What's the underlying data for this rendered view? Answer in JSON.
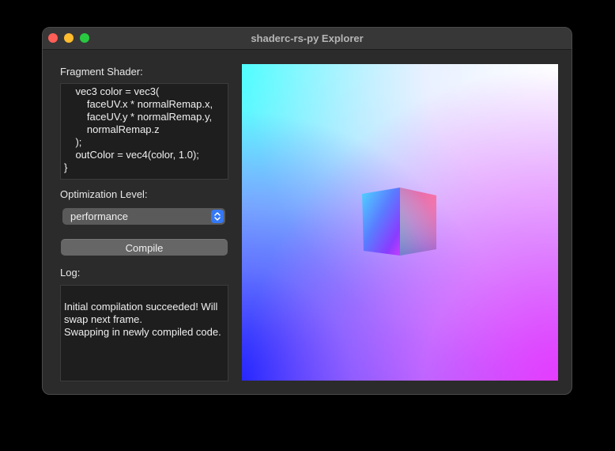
{
  "window": {
    "title": "shaderc-rs-py Explorer"
  },
  "shader": {
    "label": "Fragment Shader:",
    "code_lines": [
      "    vec3 color = vec3(",
      "        faceUV.x * normalRemap.x,",
      "        faceUV.y * normalRemap.y,",
      "        normalRemap.z",
      "    );",
      "    outColor = vec4(color, 1.0);",
      "}"
    ]
  },
  "optimization": {
    "label": "Optimization Level:",
    "selected": "performance"
  },
  "compile": {
    "label": "Compile"
  },
  "log": {
    "label": "Log:",
    "text": "Initial compilation succeeded! Will swap next frame.\nSwapping in newly compiled code."
  },
  "colors": {
    "window_bg": "#2b2b2b",
    "titlebar_bg": "#373737",
    "accent": "#3478f6",
    "close": "#ff5f57",
    "minimize": "#febc2e",
    "maximize": "#28c840"
  },
  "icons": {
    "close": "close-icon",
    "minimize": "minimize-icon",
    "maximize": "maximize-icon",
    "stepper": "chevron-updown-icon"
  }
}
